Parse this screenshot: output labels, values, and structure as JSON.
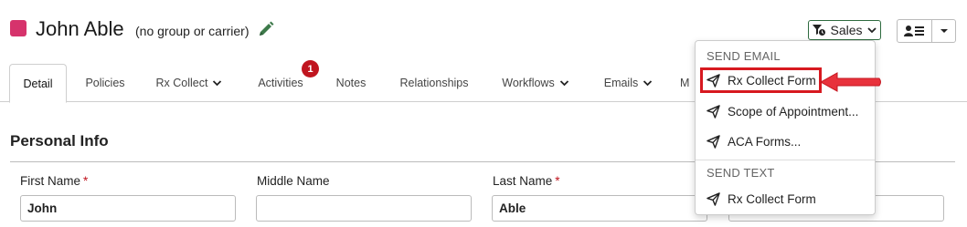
{
  "contact": {
    "name": "John Able",
    "subtitle": "(no group or carrier)",
    "color": "#d6336c"
  },
  "toolbar": {
    "sales_label": "Sales"
  },
  "tabs": [
    {
      "label": "Detail",
      "active": true
    },
    {
      "label": "Policies"
    },
    {
      "label": "Rx Collect",
      "dropdown": true
    },
    {
      "label": "Activities",
      "badge": "1"
    },
    {
      "label": "Notes"
    },
    {
      "label": "Relationships"
    },
    {
      "label": "Workflows",
      "dropdown": true
    },
    {
      "label": "Emails",
      "dropdown": true
    },
    {
      "label": "M"
    }
  ],
  "section": {
    "title": "Personal Info"
  },
  "fields": [
    {
      "label": "First Name",
      "required_mark": "*",
      "value": "John"
    },
    {
      "label": "Middle Name",
      "value": ""
    },
    {
      "label": "Last Name",
      "required_mark": "*",
      "value": "Able"
    },
    {
      "value": ""
    }
  ],
  "menu": {
    "send_email_header": "SEND EMAIL",
    "email_items": [
      "Rx Collect Form",
      "Scope of Appointment...",
      "ACA Forms..."
    ],
    "send_text_header": "SEND TEXT",
    "text_items": [
      "Rx Collect Form"
    ]
  },
  "colors": {
    "accent_green": "#2e6b3f",
    "badge_red": "#c0151f",
    "highlight_red": "#d71920",
    "arrow_red": "#e8323c"
  }
}
